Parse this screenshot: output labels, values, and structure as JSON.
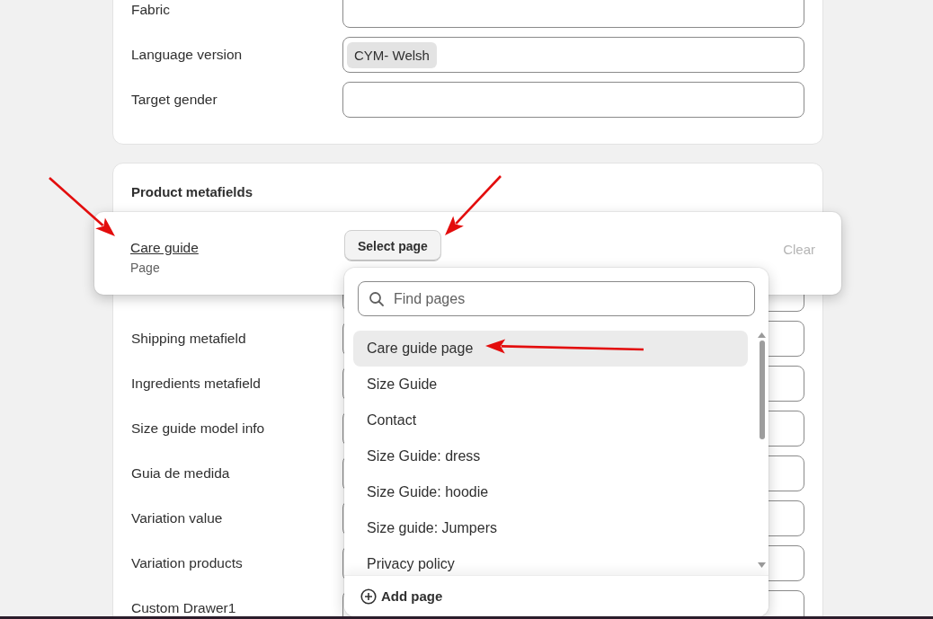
{
  "top_card": {
    "fields": [
      {
        "label": "Fabric"
      },
      {
        "label": "Language version",
        "tags": [
          "CYM- Welsh"
        ]
      },
      {
        "label": "Target gender"
      }
    ]
  },
  "metafields_card": {
    "title": "Product metafields",
    "rows": [
      {},
      {
        "label": "Shipping metafield"
      },
      {
        "label": "Ingredients metafield"
      },
      {
        "label": "Size guide model info"
      },
      {
        "label": "Guia de medida"
      },
      {
        "label": "Variation value"
      },
      {
        "label": "Variation products"
      },
      {
        "label": "Custom Drawer1"
      }
    ]
  },
  "focused_row": {
    "label": "Care guide",
    "type": "Page",
    "button": "Select page",
    "clear": "Clear"
  },
  "dropdown": {
    "search": {
      "placeholder": "Find pages"
    },
    "items": [
      {
        "label": "Care guide page",
        "selected": true
      },
      {
        "label": "Size Guide",
        "selected": false
      },
      {
        "label": "Contact",
        "selected": false
      },
      {
        "label": "Size Guide: dress",
        "selected": false
      },
      {
        "label": "Size Guide: hoodie",
        "selected": false
      },
      {
        "label": "Size guide: Jumpers",
        "selected": false
      },
      {
        "label": "Privacy policy",
        "selected": false
      }
    ],
    "footer_action": "Add page"
  }
}
